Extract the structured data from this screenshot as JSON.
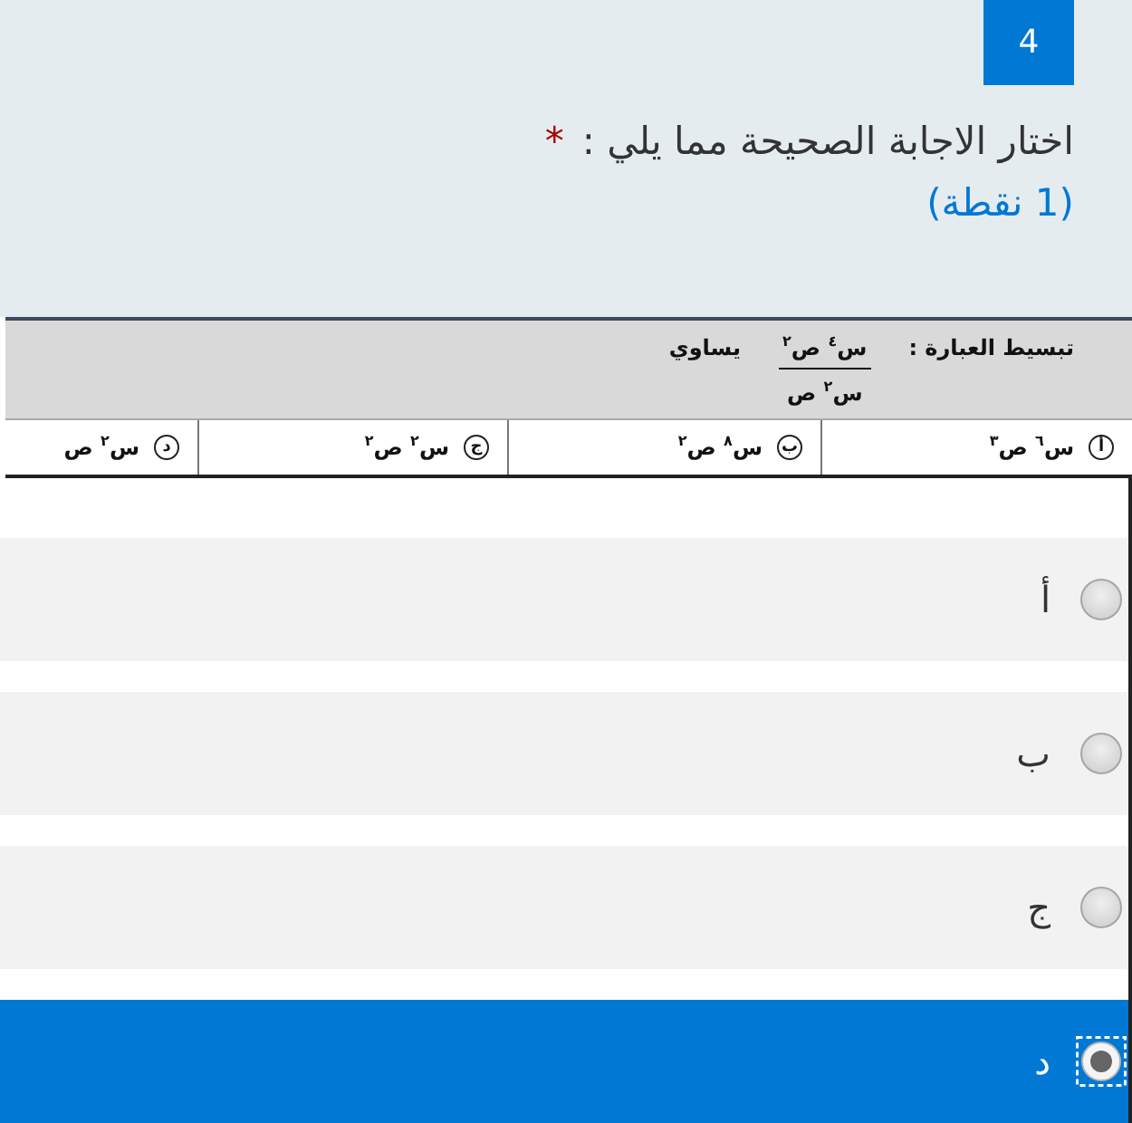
{
  "question": {
    "number": "4",
    "text": "اختار الاجابة الصحيحة مما يلي :",
    "required_mark": "*",
    "points": "(1 نقطة)"
  },
  "question_image": {
    "prompt": "تبسيط العبارة :",
    "fraction": {
      "numerator": "س$^{٤}$ ص$^{٢}$",
      "denominator": "س$^{٢}$ ص"
    },
    "suffix": "يساوي",
    "choices": [
      {
        "letter": "أ",
        "expression": "س$^{٦}$ ص$^{٣}$"
      },
      {
        "letter": "ب",
        "expression": "س$^{٨}$ ص$^{٢}$"
      },
      {
        "letter": "ج",
        "expression": "س$^{٢}$ ص$^{٢}$"
      },
      {
        "letter": "د",
        "expression": "س$^{٢}$ ص"
      }
    ]
  },
  "options": [
    {
      "label": "أ",
      "selected": false
    },
    {
      "label": "ب",
      "selected": false
    },
    {
      "label": "ج",
      "selected": false
    },
    {
      "label": "د",
      "selected": true
    }
  ]
}
